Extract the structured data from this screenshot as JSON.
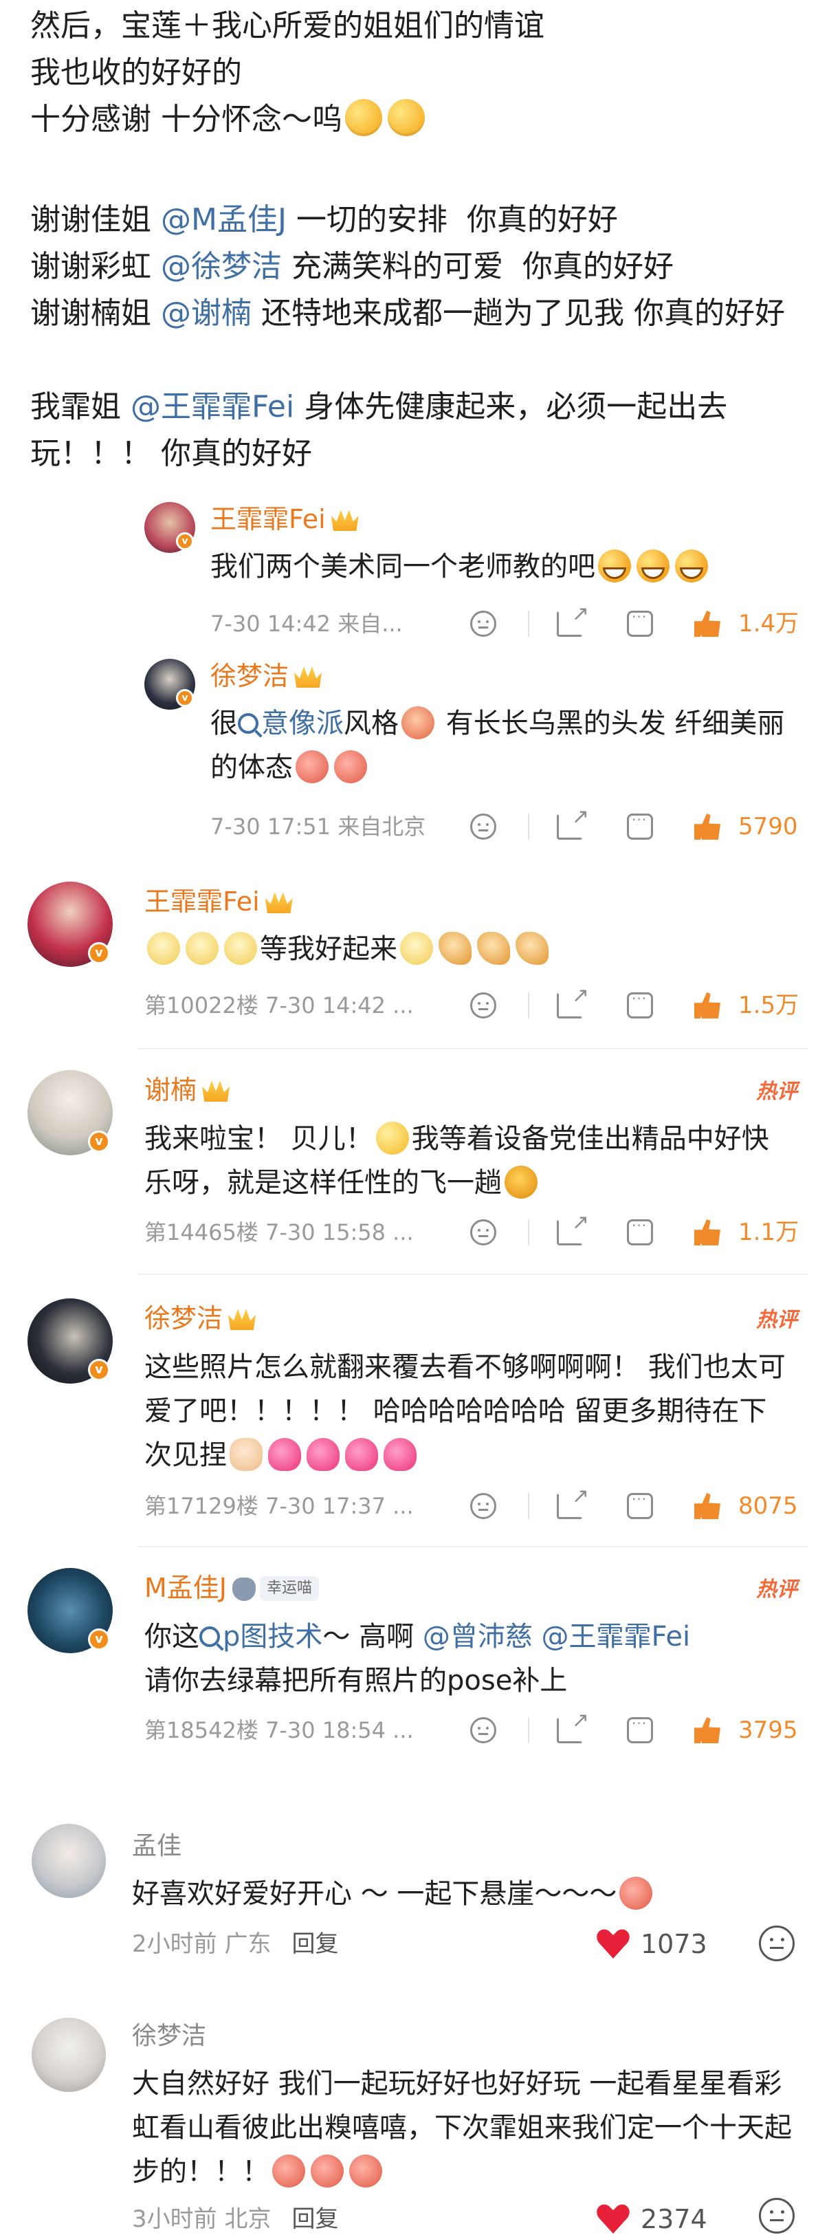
{
  "post": {
    "line1": "然后，宝莲＋我心所爱的姐姐们的情谊",
    "line2": "我也收的好好的",
    "line3": "十分感谢 十分怀念～呜",
    "thanks1_pre": "谢谢佳姐 ",
    "thanks1_mention": "@M孟佳J",
    "thanks1_post": " 一切的安排  你真的好好",
    "thanks2_pre": "谢谢彩虹 ",
    "thanks2_mention": "@徐梦洁",
    "thanks2_post": " 充满笑料的可爱  你真的好好",
    "thanks3_pre": "谢谢楠姐 ",
    "thanks3_mention": "@谢楠",
    "thanks3_post": " 还特地来成都一趟为了见我 你真的好好",
    "thanks4_pre": "我霏姐 ",
    "thanks4_mention": "@王霏霏Fei",
    "thanks4_post": " 身体先健康起来，必须一起出去玩！！！ 你真的好好"
  },
  "sub_replies": [
    {
      "name": "王霏霏Fei",
      "text": "我们两个美术同一个老师教的吧",
      "meta": "7-30 14:42  来自...",
      "likes": "1.4万"
    },
    {
      "name": "徐梦洁",
      "text_pre": "很",
      "topic": "意像派",
      "text_mid": "风格",
      "text_post": " 有长长乌黑的头发 纤细美丽的体态",
      "meta": "7-30 17:51  来自北京",
      "likes": "5790"
    }
  ],
  "comments": [
    {
      "name": "王霏霏Fei",
      "text": "等我好起来",
      "meta": "第10022楼  7-30 14:42  ...",
      "likes": "1.5万"
    },
    {
      "name": "谢楠",
      "hot": "热评",
      "text_a": "我来啦宝！ 贝儿！",
      "text_b": "我等着设备党佳出精品中好快乐呀，就是这样任性的飞一趟",
      "meta": "第14465楼  7-30 15:58  ...",
      "likes": "1.1万"
    },
    {
      "name": "徐梦洁",
      "hot": "热评",
      "text": "这些照片怎么就翻来覆去看不够啊啊啊！ 我们也太可爱了吧！！！！！  哈哈哈哈哈哈哈  留更多期待在下次见捏",
      "meta": "第17129楼  7-30 17:37  ...",
      "likes": "8075"
    },
    {
      "name": "M孟佳J",
      "badge": "幸运喵",
      "hot": "热评",
      "text_pre": "你这",
      "topic": "p图技术",
      "text_mid": "～ 高啊 ",
      "mention1": "@曾沛慈",
      "mention2": " @王霏霏Fei",
      "text_post": "请你去绿幕把所有照片的pose补上",
      "meta": "第18542楼  7-30 18:54  ...",
      "likes": "3795"
    }
  ],
  "bottom_comments": [
    {
      "name": "孟佳",
      "text": "好喜欢好爱好开心 ～ 一起下悬崖～～～",
      "time": "2小时前  广东",
      "reply": "回复",
      "likes": "1073"
    },
    {
      "name": "徐梦洁",
      "text": "大自然好好 我们一起玩好好也好好玩 一起看星星看彩虹看山看彼此出糗嘻嘻，下次霏姐来我们定一个十天起步的！！！",
      "time": "3小时前  北京",
      "reply": "回复",
      "likes": "2374"
    }
  ],
  "colors": {
    "accent_orange": "#e8791e",
    "like_orange": "#f08a2a",
    "link_blue": "#3f6fa3",
    "heart_red": "#e8213a",
    "hot_red": "#f26a3c"
  },
  "icons": [
    "crown-icon",
    "verified-icon",
    "emoji-face-icon",
    "share-icon",
    "comment-icon",
    "like-icon",
    "heart-icon",
    "search-topic-icon"
  ]
}
